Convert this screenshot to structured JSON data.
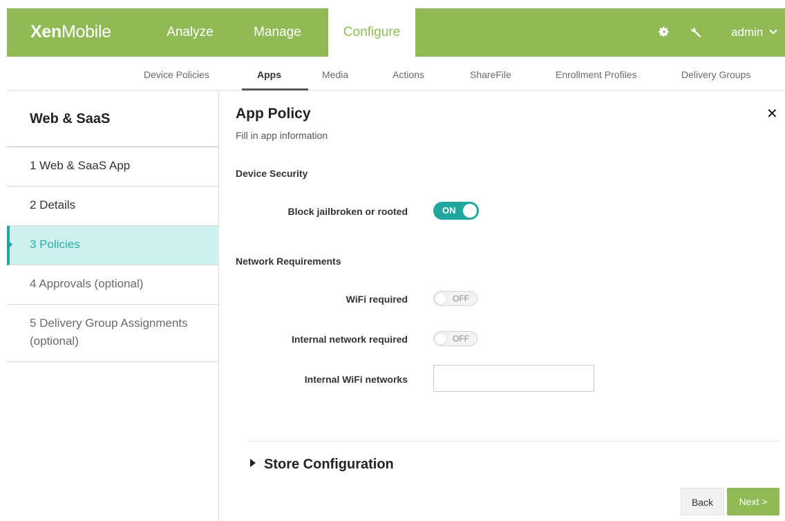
{
  "header": {
    "logo_bold": "Xen",
    "logo_rest": "Mobile",
    "tabs": [
      {
        "label": "Analyze"
      },
      {
        "label": "Manage"
      },
      {
        "label": "Configure",
        "active": true
      }
    ],
    "settings_icon": "gear-icon",
    "tools_icon": "wrench-icon",
    "user": "admin"
  },
  "subnav": {
    "items": [
      {
        "label": "Device Policies"
      },
      {
        "label": "Apps",
        "active": true
      },
      {
        "label": "Media"
      },
      {
        "label": "Actions"
      },
      {
        "label": "ShareFile"
      },
      {
        "label": "Enrollment Profiles"
      },
      {
        "label": "Delivery Groups"
      }
    ]
  },
  "sidebar": {
    "title": "Web & SaaS",
    "steps": [
      {
        "label": "1  Web & SaaS App"
      },
      {
        "label": "2  Details"
      },
      {
        "label": "3  Policies",
        "active": true
      },
      {
        "label": "4  Approvals (optional)"
      },
      {
        "label": "5  Delivery Group Assignments",
        "label2": "(optional)"
      }
    ]
  },
  "main": {
    "title": "App Policy",
    "subtitle": "Fill in app information",
    "device_security": {
      "heading": "Device Security",
      "block_jailbroken": {
        "label": "Block jailbroken or rooted",
        "state": "ON"
      }
    },
    "network": {
      "heading": "Network Requirements",
      "wifi_required": {
        "label": "WiFi required",
        "state": "OFF"
      },
      "internal_required": {
        "label": "Internal network required",
        "state": "OFF"
      },
      "internal_wifi": {
        "label": "Internal WiFi networks",
        "value": ""
      }
    },
    "store_configuration": "Store Configuration",
    "buttons": {
      "back": "Back",
      "next": "Next >"
    }
  },
  "colors": {
    "brand_green": "#8fba56",
    "accent_teal": "#1fa79e",
    "active_step_bg": "#ccf1ee"
  }
}
